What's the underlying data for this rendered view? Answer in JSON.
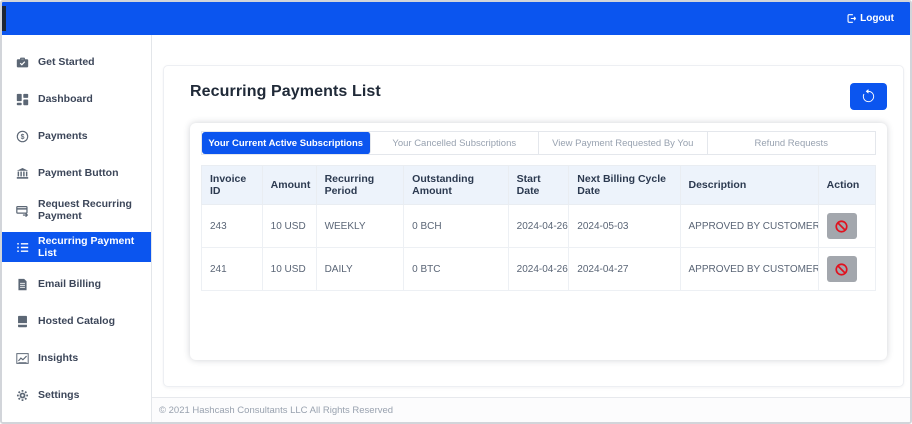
{
  "colors": {
    "primary_blue": "#0b55ef",
    "danger_red": "#e0121f",
    "action_button_gray": "#a3a7ad",
    "table_header_bg": "#edf3fb"
  },
  "topbar": {
    "logout": {
      "label": "Logout",
      "icon": "logout-icon"
    }
  },
  "sidebar": {
    "items": [
      {
        "label": "Get Started",
        "icon": "briefcase-check-icon",
        "active": false
      },
      {
        "label": "Dashboard",
        "icon": "dashboard-grid-icon",
        "active": false
      },
      {
        "label": "Payments",
        "icon": "dollar-circle-icon",
        "active": false
      },
      {
        "label": "Payment Button",
        "icon": "bank-icon",
        "active": false
      },
      {
        "label": "Request Recurring Payment",
        "icon": "card-arrow-icon",
        "active": false
      },
      {
        "label": "Recurring Payment List",
        "icon": "list-icon",
        "active": true
      },
      {
        "label": "Email Billing",
        "icon": "document-icon",
        "active": false
      },
      {
        "label": "Hosted Catalog",
        "icon": "book-icon",
        "active": false
      },
      {
        "label": "Insights",
        "icon": "chart-icon",
        "active": false
      },
      {
        "label": "Settings",
        "icon": "gear-icon",
        "active": false
      }
    ]
  },
  "main": {
    "title": "Recurring Payments List",
    "history_button": {
      "icon": "history-icon"
    },
    "tabs": [
      {
        "label": "Your Current Active Subscriptions",
        "active": true
      },
      {
        "label": "Your Cancelled Subscriptions",
        "active": false
      },
      {
        "label": "View Payment Requested By You",
        "active": false
      },
      {
        "label": "Refund Requests",
        "active": false
      }
    ],
    "table": {
      "columns": [
        "Invoice ID",
        "Amount",
        "Recurring Period",
        "Outstanding Amount",
        "Start Date",
        "Next Billing Cycle Date",
        "Description",
        "Action"
      ],
      "row_keys": [
        "invoice_id",
        "amount",
        "recurring_period",
        "outstanding_amount",
        "start_date",
        "next_billing_cycle_date",
        "description"
      ],
      "rows": [
        {
          "invoice_id": "243",
          "amount": "10 USD",
          "recurring_period": "WEEKLY",
          "outstanding_amount": "0 BCH",
          "start_date": "2024-04-26",
          "next_billing_cycle_date": "2024-05-03",
          "description": "APPROVED BY CUSTOMER",
          "action_icon": "cancel-icon"
        },
        {
          "invoice_id": "241",
          "amount": "10 USD",
          "recurring_period": "DAILY",
          "outstanding_amount": "0 BTC",
          "start_date": "2024-04-26",
          "next_billing_cycle_date": "2024-04-27",
          "description": "APPROVED BY CUSTOMER",
          "action_icon": "cancel-icon"
        }
      ]
    }
  },
  "footer": {
    "copyright": "© 2021 Hashcash Consultants LLC All Rights Reserved"
  }
}
